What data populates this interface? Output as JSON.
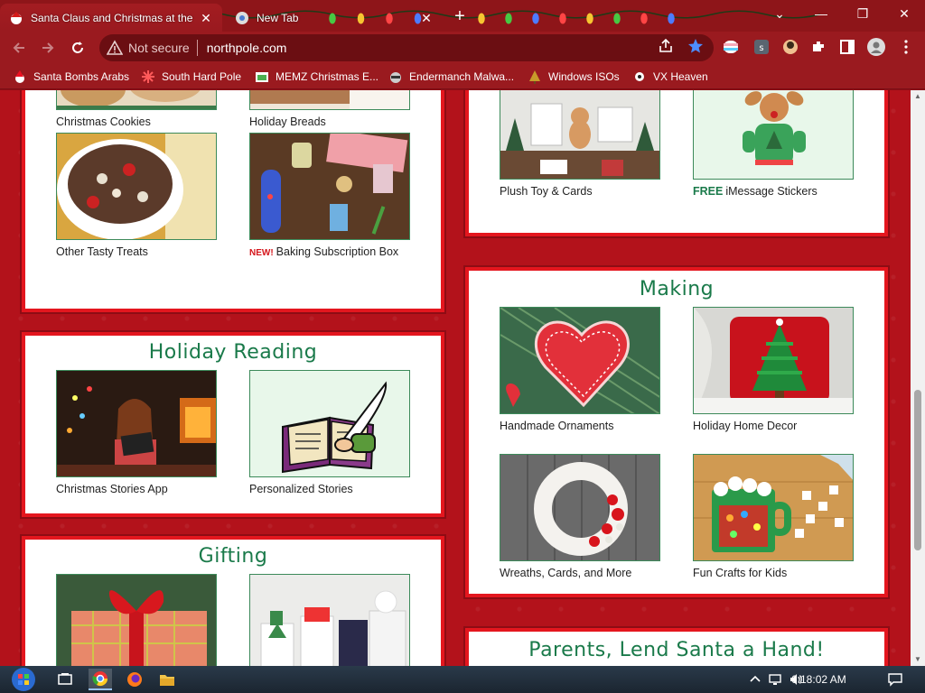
{
  "browser": {
    "tabs": [
      {
        "title": "Santa Claus and Christmas at the",
        "active": true
      },
      {
        "title": "New Tab",
        "active": false
      }
    ],
    "address": {
      "security_label": "Not secure",
      "url": "northpole.com"
    },
    "bookmarks": [
      {
        "label": "Santa Bombs Arabs",
        "icon": "santa-icon"
      },
      {
        "label": "South Hard Pole",
        "icon": "snowflake-icon"
      },
      {
        "label": "MEMZ Christmas E...",
        "icon": "present-icon"
      },
      {
        "label": "Endermanch Malwa...",
        "icon": "raccoon-icon"
      },
      {
        "label": "Windows ISOs",
        "icon": "tree-icon"
      },
      {
        "label": "VX Heaven",
        "icon": "virus-icon"
      }
    ],
    "accent_color": "#9a1a1f"
  },
  "page": {
    "sections": {
      "baking": {
        "tiles": [
          {
            "caption": "Christmas Cookies"
          },
          {
            "caption": "Holiday Breads"
          },
          {
            "caption": "Other Tasty Treats"
          },
          {
            "badge": "NEW!",
            "caption": "Baking Subscription Box"
          }
        ]
      },
      "gifts_top": {
        "tiles": [
          {
            "caption": "Plush Toy & Cards"
          },
          {
            "badge": "FREE",
            "caption": "iMessage Stickers"
          }
        ]
      },
      "reading": {
        "title": "Holiday Reading",
        "tiles": [
          {
            "caption": "Christmas Stories App"
          },
          {
            "caption": "Personalized Stories"
          }
        ]
      },
      "gifting": {
        "title": "Gifting"
      },
      "making": {
        "title": "Making",
        "tiles": [
          {
            "caption": "Handmade Ornaments"
          },
          {
            "caption": "Holiday Home Decor"
          },
          {
            "caption": "Wreaths, Cards, and More"
          },
          {
            "caption": "Fun Crafts for Kids"
          }
        ]
      },
      "parents": {
        "title": "Parents, Lend Santa a Hand!"
      }
    },
    "title_color": "#1a7a4a",
    "frame_color": "#e4161e"
  },
  "taskbar": {
    "clock": "6:18:02 AM",
    "apps": [
      "start-orb",
      "task-view",
      "chrome",
      "firefox",
      "file-explorer"
    ]
  }
}
